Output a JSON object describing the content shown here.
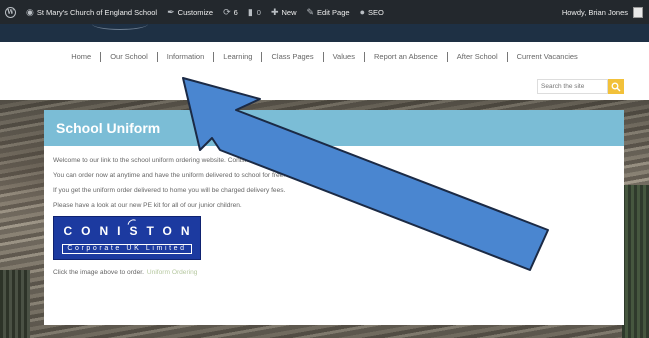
{
  "admin_bar": {
    "site_name": "St Mary's Church of England School",
    "customize": "Customize",
    "updates_count": "6",
    "comments_count": "0",
    "new_label": "New",
    "edit_page": "Edit Page",
    "seo": "SEO",
    "howdy": "Howdy, Brian Jones"
  },
  "nav": {
    "items": [
      "Home",
      "Our School",
      "Information",
      "Learning",
      "Class Pages",
      "Values",
      "Report an Absence",
      "After School",
      "Current Vacancies"
    ]
  },
  "search": {
    "placeholder": "Search the site"
  },
  "panel": {
    "title": "School Uniform",
    "paragraphs": [
      "Welcome to our link to the school uniform ordering website. Coniston Corpo",
      "You can order now at anytime and have the uniform delivered to school for free.",
      "If you get the uniform order delivered to home you will be charged delivery fees.",
      "Please have a look at our new PE kit for all of our junior children."
    ],
    "logo": {
      "top": "CONISTON",
      "bottom": "Corporate UK Limited"
    },
    "click_text": "Click the image above to order.",
    "link_text": "Uniform Ordering"
  },
  "colors": {
    "admin_bar": "#23282d",
    "header_band": "#1e3044",
    "panel_header": "#7bbdd6",
    "search_button": "#f2c13a",
    "arrow_fill": "#4a86d0",
    "arrow_stroke": "#1b2a45",
    "logo_background": "#1c3aa0"
  }
}
